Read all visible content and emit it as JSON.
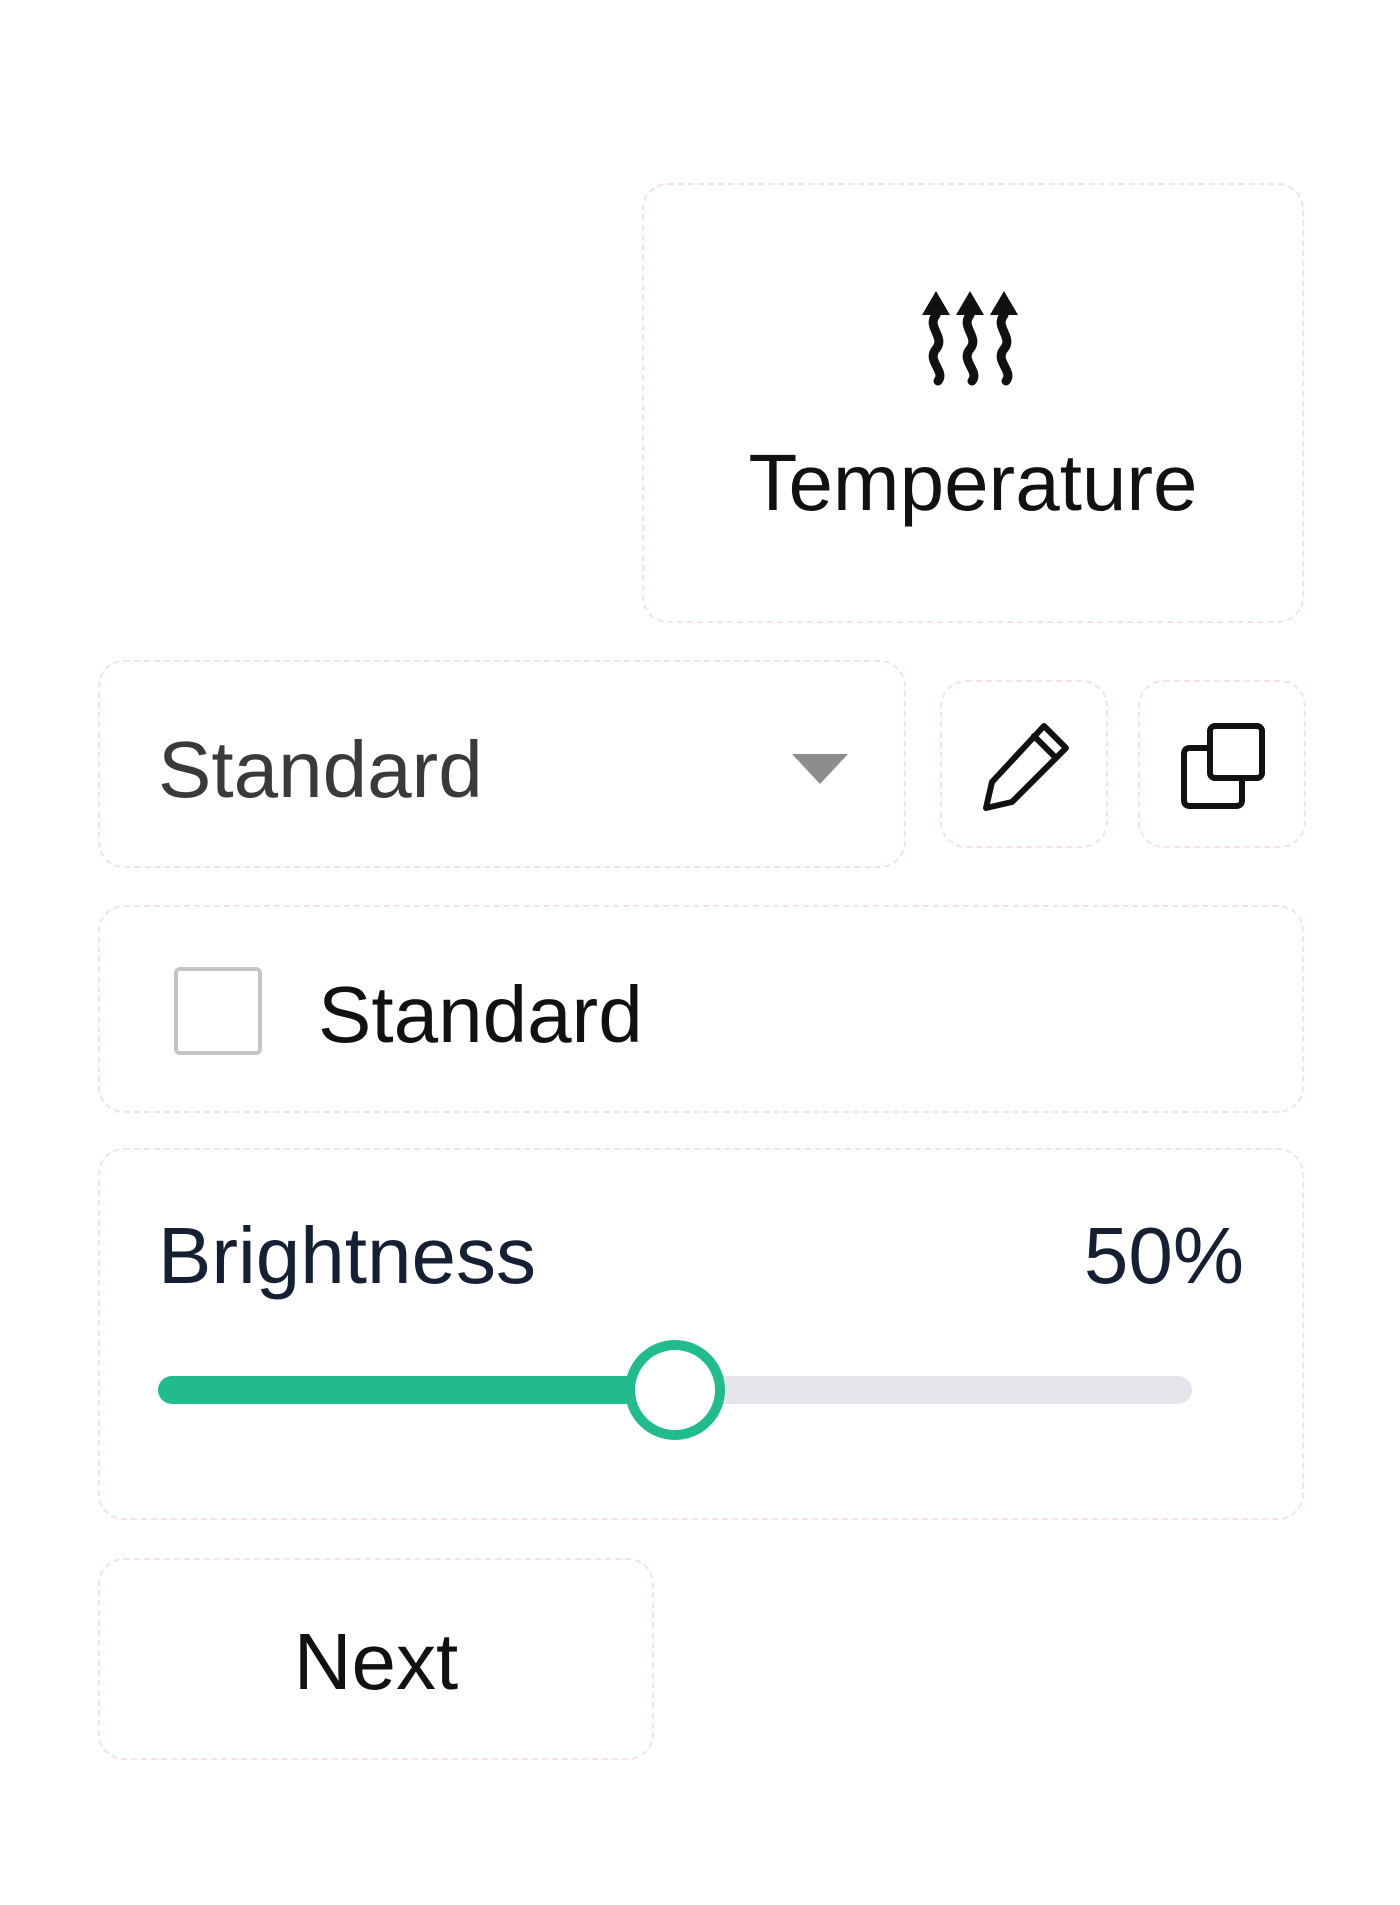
{
  "temperature_tile": {
    "icon": "heat-icon",
    "label": "Temperature"
  },
  "preset_dropdown": {
    "value": "Standard",
    "icon": "chevron-down-icon"
  },
  "actions": {
    "edit_icon": "pencil-icon",
    "copy_icon": "copy-icon"
  },
  "checkbox": {
    "label": "Standard",
    "checked": false
  },
  "brightness": {
    "label": "Brightness",
    "value_text": "50%",
    "value": 0.5
  },
  "next_button": {
    "label": "Next"
  },
  "colors": {
    "accent": "#21bb8e",
    "track": "#e4e5ea",
    "text": "#111111",
    "label_dark": "#162033"
  }
}
